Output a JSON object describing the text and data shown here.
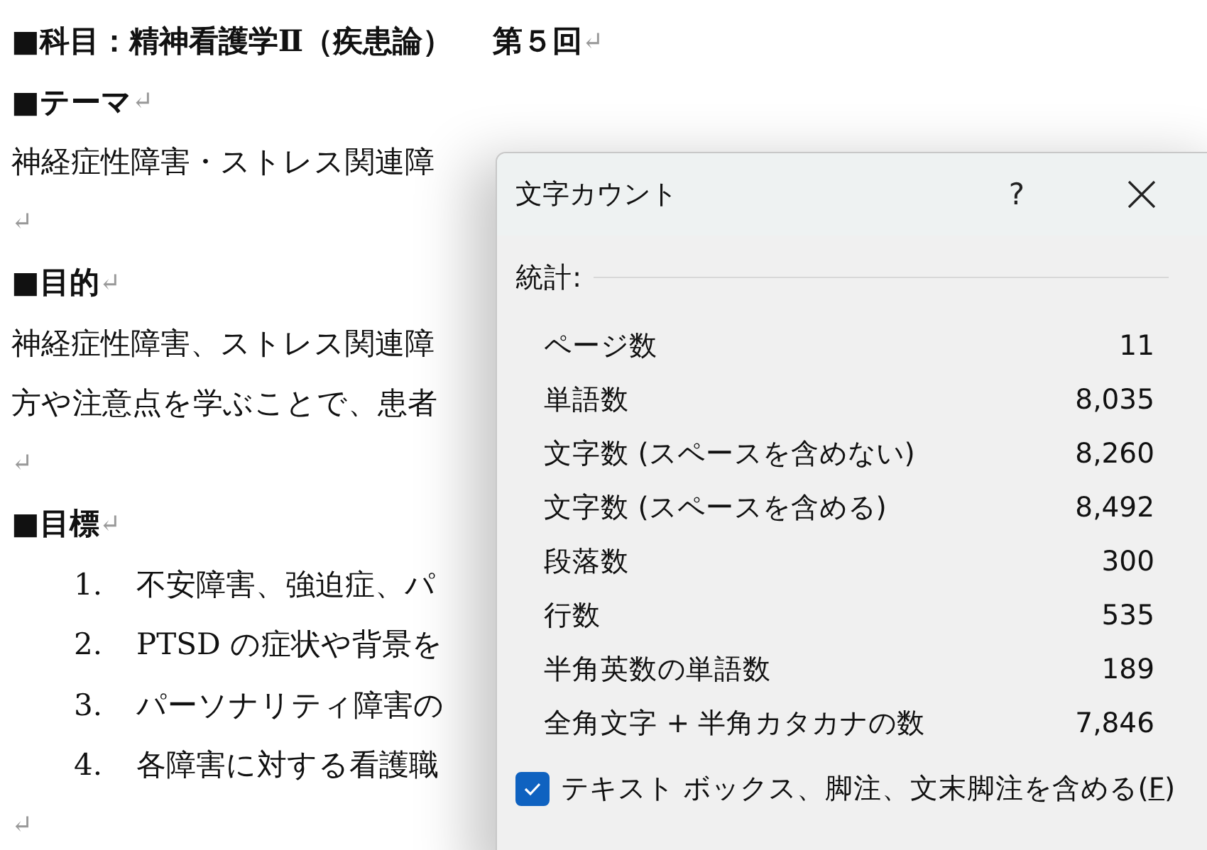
{
  "document": {
    "paragraphs": [
      {
        "kind": "heading",
        "text": "■科目：精神看護学Ⅱ（疾患論）　 第５回",
        "mark": "↵"
      },
      {
        "kind": "heading",
        "text": "■テーマ",
        "mark": "↵"
      },
      {
        "kind": "body",
        "text": "神経症性障害・ストレス関連障"
      },
      {
        "kind": "empty",
        "mark": "↵"
      },
      {
        "kind": "heading",
        "text": "■目的",
        "mark": "↵"
      },
      {
        "kind": "body",
        "text": "神経症性障害、ストレス関連障"
      },
      {
        "kind": "body",
        "text": "方や注意点を学ぶことで、患者"
      },
      {
        "kind": "empty",
        "mark": "↵"
      },
      {
        "kind": "heading",
        "text": "■目標",
        "mark": "↵"
      },
      {
        "kind": "list",
        "number": "1.",
        "text": "不安障害、強迫症、パ"
      },
      {
        "kind": "list",
        "number": "2.",
        "text": "PTSD の症状や背景を"
      },
      {
        "kind": "list",
        "number": "3.",
        "text": "パーソナリティ障害の"
      },
      {
        "kind": "list",
        "number": "4.",
        "text": "各障害に対する看護職"
      },
      {
        "kind": "empty",
        "mark": "↵"
      }
    ]
  },
  "dialog": {
    "title": "文字カウント",
    "help": "?",
    "section": "統計:",
    "stats": [
      {
        "label": "ページ数",
        "value": "11"
      },
      {
        "label": "単語数",
        "value": "8,035"
      },
      {
        "label": "文字数 (スペースを含めない)",
        "value": "8,260"
      },
      {
        "label": "文字数 (スペースを含める)",
        "value": "8,492"
      },
      {
        "label": "段落数",
        "value": "300"
      },
      {
        "label": "行数",
        "value": "535"
      },
      {
        "label": "半角英数の単語数",
        "value": "189"
      },
      {
        "label": "全角文字 + 半角カタカナの数",
        "value": "7,846"
      }
    ],
    "option": {
      "label": "テキスト ボックス、脚注、文末脚注を含める(",
      "accel": "F",
      "tail": ")",
      "checked": true
    }
  }
}
